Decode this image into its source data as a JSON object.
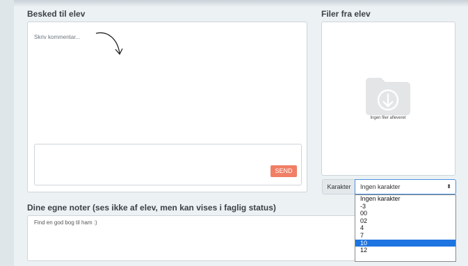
{
  "message": {
    "heading": "Besked til elev",
    "comment_placeholder": "Skriv kommentar...",
    "send_label": "SEND"
  },
  "files": {
    "heading": "Filer fra elev",
    "empty_text": "Ingen filer afleveret",
    "icon": "download-folder-icon"
  },
  "grade": {
    "label": "Karakter",
    "selected": "Ingen karakter",
    "options": [
      "Ingen karakter",
      "-3",
      "00",
      "02",
      "4",
      "7",
      "10",
      "12"
    ],
    "highlighted": "10"
  },
  "notes": {
    "heading": "Dine egne noter (ses ikke af elev, men kan vises i faglig status)",
    "text": "Find en god bog til ham :)"
  },
  "colors": {
    "send": "#f07f66",
    "highlight": "#1e74e0"
  }
}
